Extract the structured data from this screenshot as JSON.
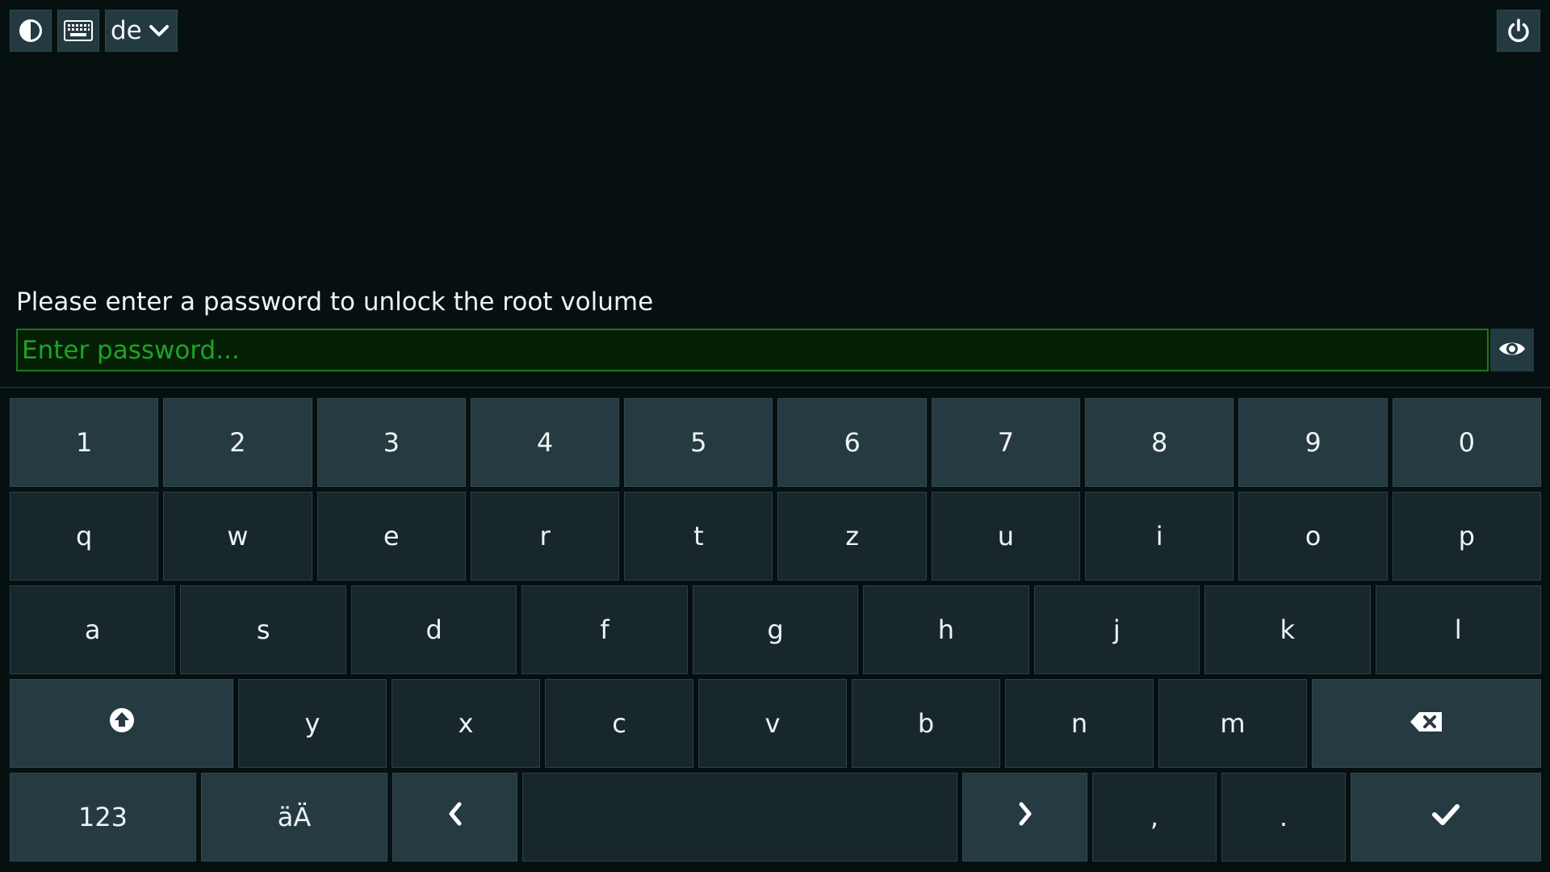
{
  "topbar": {
    "language": "de"
  },
  "prompt": "Please enter a password to unlock the root volume",
  "password": {
    "placeholder": "Enter password...",
    "value": ""
  },
  "keyboard": {
    "row_numbers": [
      "1",
      "2",
      "3",
      "4",
      "5",
      "6",
      "7",
      "8",
      "9",
      "0"
    ],
    "row_top": [
      "q",
      "w",
      "e",
      "r",
      "t",
      "z",
      "u",
      "i",
      "o",
      "p"
    ],
    "row_home": [
      "a",
      "s",
      "d",
      "f",
      "g",
      "h",
      "j",
      "k",
      "l"
    ],
    "row_bottom": [
      "y",
      "x",
      "c",
      "v",
      "b",
      "n",
      "m"
    ],
    "mode_numbers_label": "123",
    "mode_umlaut_label": "äÄ",
    "comma": ",",
    "period": "."
  },
  "icons": {
    "contrast": "contrast-icon",
    "keyboard": "keyboard-icon",
    "chevron": "chevron-down-icon",
    "power": "power-icon",
    "eye": "eye-icon",
    "shift": "shift-icon",
    "backspace": "backspace-icon",
    "left": "chevron-left-icon",
    "right": "chevron-right-icon",
    "enter": "check-icon"
  }
}
